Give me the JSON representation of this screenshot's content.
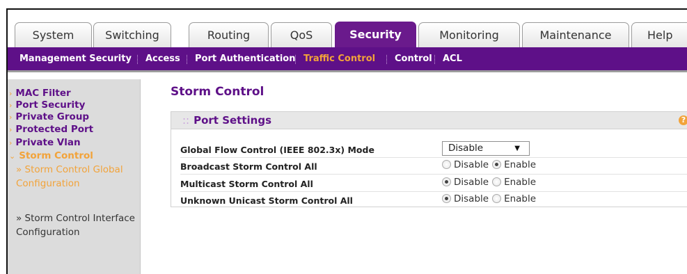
{
  "tabs": [
    {
      "label": "System",
      "active": false
    },
    {
      "label": "Switching",
      "active": false
    },
    {
      "label": "Routing",
      "active": false
    },
    {
      "label": "QoS",
      "active": false
    },
    {
      "label": "Security",
      "active": true
    },
    {
      "label": "Monitoring",
      "active": false
    },
    {
      "label": "Maintenance",
      "active": false
    },
    {
      "label": "Help",
      "active": false
    }
  ],
  "submenu": [
    {
      "label": "Management Security",
      "active": false
    },
    {
      "label": "Access",
      "active": false
    },
    {
      "label": "Port Authentication",
      "active": false
    },
    {
      "label": "Traffic Control",
      "active": true
    },
    {
      "label": "Control",
      "active": false
    },
    {
      "label": "ACL",
      "active": false
    }
  ],
  "leftnav": {
    "items": [
      {
        "label": "MAC Filter"
      },
      {
        "label": "Port Security"
      },
      {
        "label": "Private Group"
      },
      {
        "label": "Protected Port"
      },
      {
        "label": "Private Vlan"
      },
      {
        "label": "Storm Control",
        "expanded": true
      }
    ],
    "sub_items": [
      {
        "label": "» Storm Control Global Configuration",
        "active": true
      },
      {
        "label": "» Storm Control Interface Configuration",
        "active": false
      }
    ]
  },
  "main": {
    "title": "Storm Control",
    "panel": {
      "title": "Port Settings",
      "header_prefix": "::",
      "help_glyph": "?",
      "rows": [
        {
          "label": "Global Flow Control (IEEE 802.3x) Mode",
          "type": "select",
          "value": "Disable",
          "arrow": "▼"
        },
        {
          "label": "Broadcast Storm Control All",
          "type": "radio",
          "options": [
            "Disable",
            "Enable"
          ],
          "selected": "Enable"
        },
        {
          "label": "Multicast Storm Control All",
          "type": "radio",
          "options": [
            "Disable",
            "Enable"
          ],
          "selected": "Disable"
        },
        {
          "label": "Unknown Unicast Storm Control All",
          "type": "radio",
          "options": [
            "Disable",
            "Enable"
          ],
          "selected": "Disable"
        }
      ]
    }
  },
  "colors": {
    "accent": "#5e1088",
    "highlight": "#f2a33a",
    "panel_bg": "#e7e7e7",
    "nav_bg": "#dcdcdc"
  }
}
